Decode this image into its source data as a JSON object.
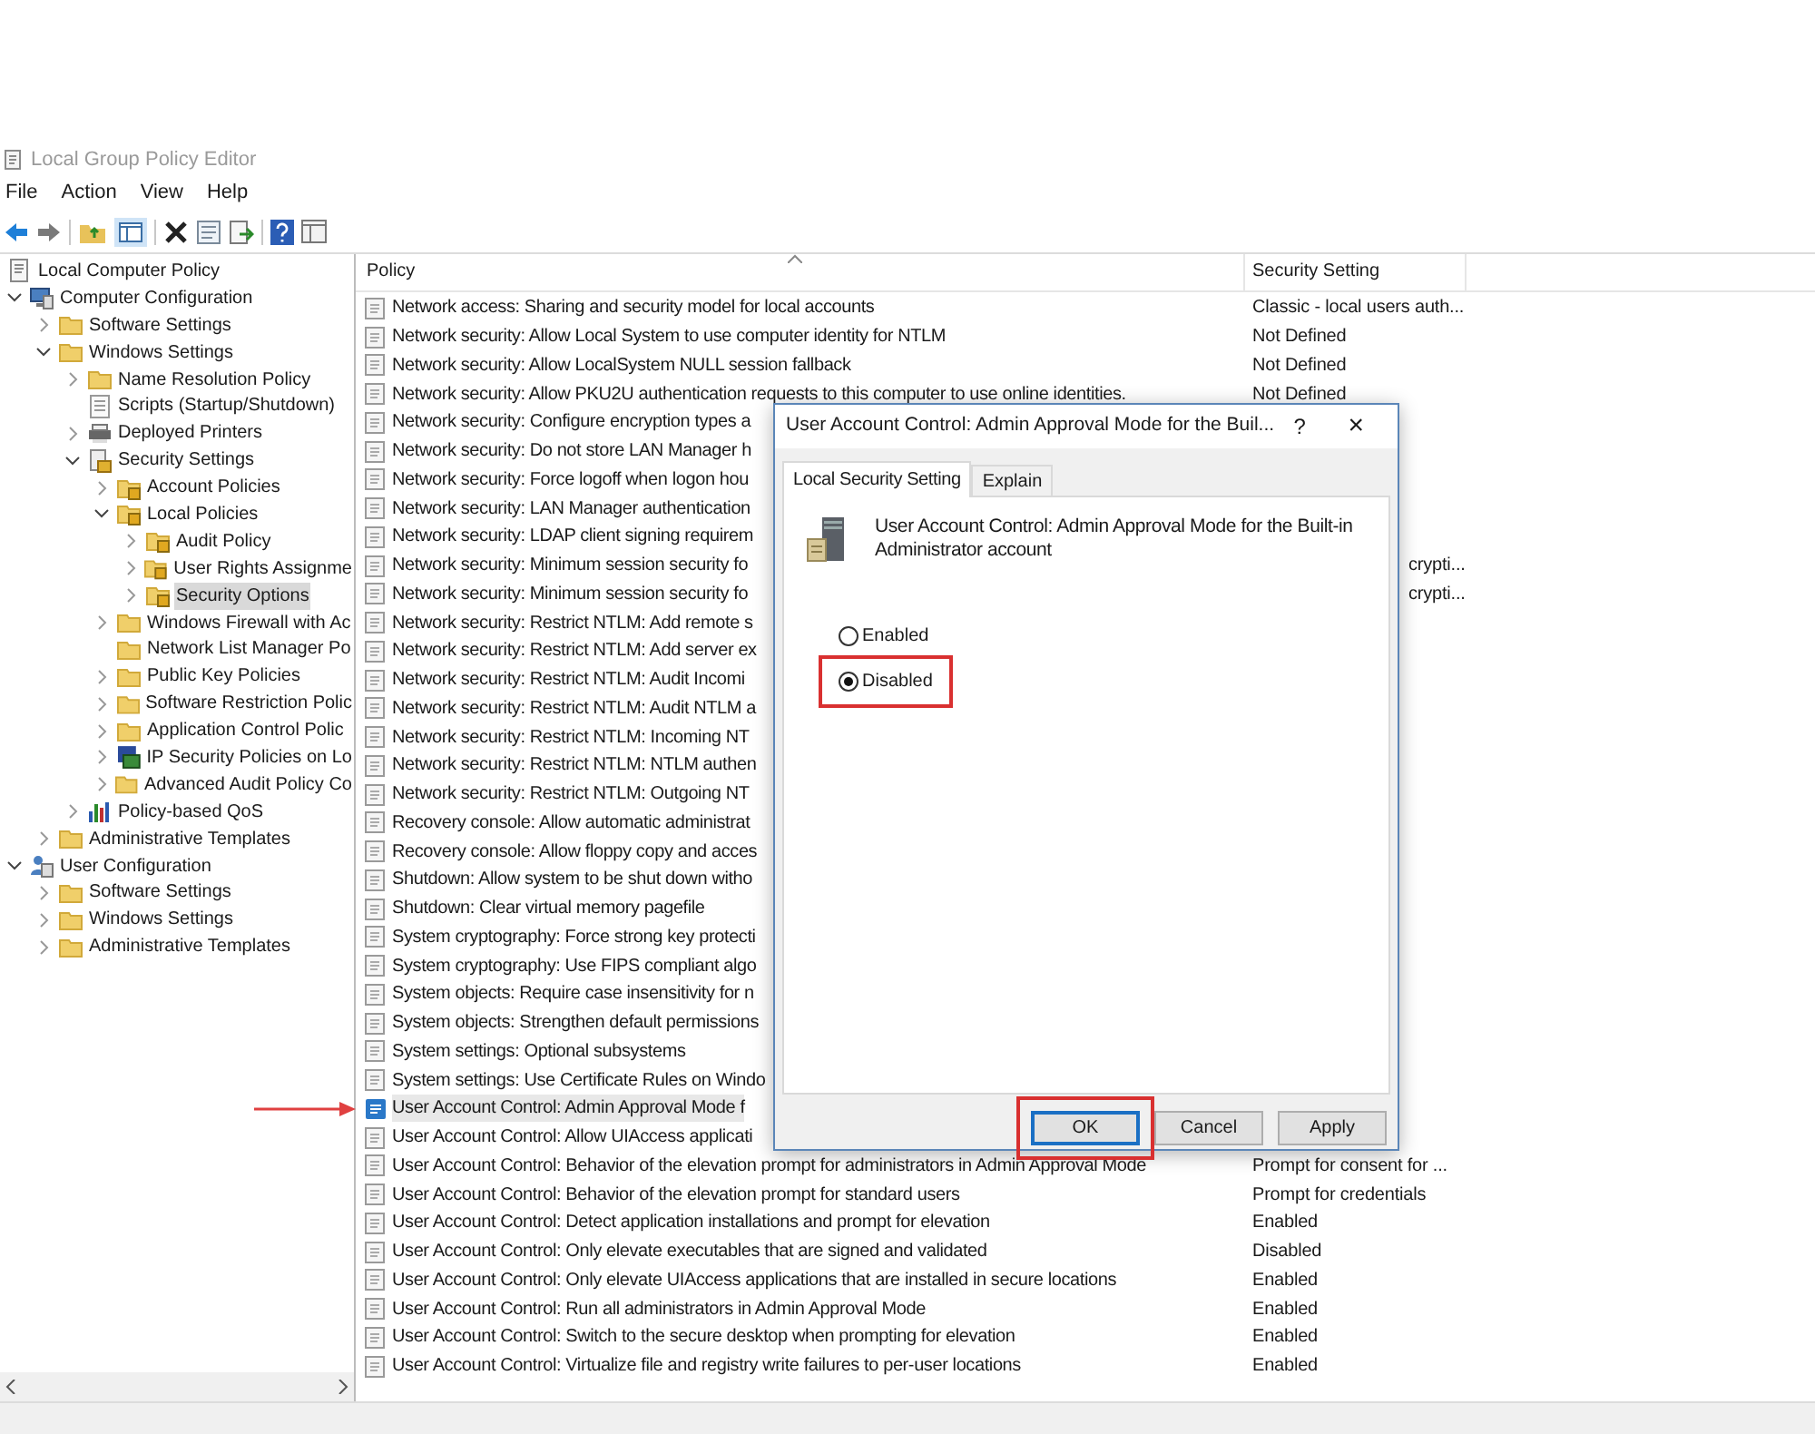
{
  "window": {
    "title": "Local Group Policy Editor"
  },
  "menu": [
    "File",
    "Action",
    "View",
    "Help"
  ],
  "tree": [
    {
      "label": "Local Computer Policy",
      "kind": "policy",
      "selected": false,
      "children": [
        {
          "label": "Computer Configuration",
          "kind": "computer",
          "expanded": true,
          "selected": false,
          "children": [
            {
              "label": "Software Settings",
              "kind": "folder",
              "expanded": false,
              "selected": false
            },
            {
              "label": "Windows Settings",
              "kind": "folder",
              "expanded": true,
              "selected": false,
              "children": [
                {
                  "label": "Name Resolution Policy",
                  "kind": "folder",
                  "expanded": false,
                  "selected": false
                },
                {
                  "label": "Scripts (Startup/Shutdown)",
                  "kind": "script",
                  "selected": false
                },
                {
                  "label": "Deployed Printers",
                  "kind": "printer",
                  "expanded": false,
                  "selected": false
                },
                {
                  "label": "Security Settings",
                  "kind": "security",
                  "expanded": true,
                  "selected": false,
                  "children": [
                    {
                      "label": "Account Policies",
                      "kind": "lockfolder",
                      "expanded": false,
                      "selected": false
                    },
                    {
                      "label": "Local Policies",
                      "kind": "lockfolder",
                      "expanded": true,
                      "selected": false,
                      "children": [
                        {
                          "label": "Audit Policy",
                          "kind": "lockfolder",
                          "expanded": false,
                          "selected": false
                        },
                        {
                          "label": "User Rights Assignme",
                          "kind": "lockfolder",
                          "expanded": false,
                          "selected": false
                        },
                        {
                          "label": "Security Options",
                          "kind": "lockfolder",
                          "expanded": false,
                          "selected": true
                        }
                      ]
                    },
                    {
                      "label": "Windows Firewall with Ac",
                      "kind": "folder",
                      "expanded": false,
                      "selected": false
                    },
                    {
                      "label": "Network List Manager Po",
                      "kind": "folder",
                      "selected": false
                    },
                    {
                      "label": "Public Key Policies",
                      "kind": "folder",
                      "expanded": false,
                      "selected": false
                    },
                    {
                      "label": "Software Restriction Polic",
                      "kind": "folder",
                      "expanded": false,
                      "selected": false
                    },
                    {
                      "label": "Application Control Polic",
                      "kind": "folder",
                      "expanded": false,
                      "selected": false
                    },
                    {
                      "label": "IP Security Policies on Lo",
                      "kind": "ipsec",
                      "expanded": false,
                      "selected": false
                    },
                    {
                      "label": "Advanced Audit Policy Co",
                      "kind": "folder",
                      "expanded": false,
                      "selected": false
                    }
                  ]
                },
                {
                  "label": "Policy-based QoS",
                  "kind": "qos",
                  "expanded": false,
                  "selected": false
                }
              ]
            },
            {
              "label": "Administrative Templates",
              "kind": "folder",
              "expanded": false,
              "selected": false
            }
          ]
        },
        {
          "label": "User Configuration",
          "kind": "user",
          "expanded": true,
          "selected": false,
          "children": [
            {
              "label": "Software Settings",
              "kind": "folder",
              "expanded": false,
              "selected": false
            },
            {
              "label": "Windows Settings",
              "kind": "folder",
              "expanded": false,
              "selected": false
            },
            {
              "label": "Administrative Templates",
              "kind": "folder",
              "expanded": false,
              "selected": false
            }
          ]
        }
      ]
    }
  ],
  "policy_list": {
    "columns": [
      "Policy",
      "Security Setting"
    ],
    "rows": [
      {
        "policy": "Network access: Sharing and security model for local accounts",
        "setting": "Classic - local users auth...",
        "selected": false,
        "callout": false
      },
      {
        "policy": "Network security: Allow Local System to use computer identity for NTLM",
        "setting": "Not Defined",
        "selected": false,
        "callout": false
      },
      {
        "policy": "Network security: Allow LocalSystem NULL session fallback",
        "setting": "Not Defined",
        "selected": false,
        "callout": false
      },
      {
        "policy": "Network security: Allow PKU2U authentication requests to this computer to use online identities.",
        "setting": "Not Defined",
        "selected": false,
        "callout": false
      },
      {
        "policy": "Network security: Configure encryption types a",
        "selected": false,
        "callout": false
      },
      {
        "policy": "Network security: Do not store LAN Manager h",
        "selected": false,
        "callout": false
      },
      {
        "policy": "Network security: Force logoff when logon hou",
        "selected": false,
        "callout": false
      },
      {
        "policy": "Network security: LAN Manager authentication",
        "selected": false,
        "callout": false
      },
      {
        "policy": "Network security: LDAP client signing requirem",
        "selected": false,
        "callout": false
      },
      {
        "policy": "Network security: Minimum session security fo",
        "setting": "crypti...",
        "selected": false,
        "callout": false
      },
      {
        "policy": "Network security: Minimum session security fo",
        "setting": "crypti...",
        "selected": false,
        "callout": false
      },
      {
        "policy": "Network security: Restrict NTLM: Add remote s",
        "selected": false,
        "callout": false
      },
      {
        "policy": "Network security: Restrict NTLM: Add server ex",
        "selected": false,
        "callout": false
      },
      {
        "policy": "Network security: Restrict NTLM: Audit Incomi",
        "selected": false,
        "callout": false
      },
      {
        "policy": "Network security: Restrict NTLM: Audit NTLM a",
        "selected": false,
        "callout": false
      },
      {
        "policy": "Network security: Restrict NTLM: Incoming NT",
        "selected": false,
        "callout": false
      },
      {
        "policy": "Network security: Restrict NTLM: NTLM authen",
        "selected": false,
        "callout": false
      },
      {
        "policy": "Network security: Restrict NTLM: Outgoing NT",
        "selected": false,
        "callout": false
      },
      {
        "policy": "Recovery console: Allow automatic administrat",
        "selected": false,
        "callout": false
      },
      {
        "policy": "Recovery console: Allow floppy copy and acces",
        "selected": false,
        "callout": false
      },
      {
        "policy": "Shutdown: Allow system to be shut down witho",
        "selected": false,
        "callout": false
      },
      {
        "policy": "Shutdown: Clear virtual memory pagefile",
        "selected": false,
        "callout": false
      },
      {
        "policy": "System cryptography: Force strong key protecti",
        "selected": false,
        "callout": false
      },
      {
        "policy": "System cryptography: Use FIPS compliant algo",
        "selected": false,
        "callout": false
      },
      {
        "policy": "System objects: Require case insensitivity for n",
        "selected": false,
        "callout": false
      },
      {
        "policy": "System objects: Strengthen default permissions",
        "selected": false,
        "callout": false
      },
      {
        "policy": "System settings: Optional subsystems",
        "selected": false,
        "callout": false
      },
      {
        "policy": "System settings: Use Certificate Rules on Windo",
        "selected": false,
        "callout": false
      },
      {
        "policy": "User Account Control: Admin Approval Mode f",
        "selected": true,
        "callout": true
      },
      {
        "policy": "User Account Control: Allow UIAccess applicati",
        "selected": false,
        "callout": false
      },
      {
        "policy": "User Account Control: Behavior of the elevation prompt for administrators in Admin Approval Mode",
        "setting": "Prompt for consent for ...",
        "selected": false,
        "callout": false
      },
      {
        "policy": "User Account Control: Behavior of the elevation prompt for standard users",
        "setting": "Prompt for credentials",
        "selected": false,
        "callout": false
      },
      {
        "policy": "User Account Control: Detect application installations and prompt for elevation",
        "setting": "Enabled",
        "selected": false,
        "callout": false
      },
      {
        "policy": "User Account Control: Only elevate executables that are signed and validated",
        "setting": "Disabled",
        "selected": false,
        "callout": false
      },
      {
        "policy": "User Account Control: Only elevate UIAccess applications that are installed in secure locations",
        "setting": "Enabled",
        "selected": false,
        "callout": false
      },
      {
        "policy": "User Account Control: Run all administrators in Admin Approval Mode",
        "setting": "Enabled",
        "selected": false,
        "callout": false
      },
      {
        "policy": "User Account Control: Switch to the secure desktop when prompting for elevation",
        "setting": "Enabled",
        "selected": false,
        "callout": false
      },
      {
        "policy": "User Account Control: Virtualize file and registry write failures to per-user locations",
        "setting": "Enabled",
        "selected": false,
        "callout": false
      }
    ]
  },
  "dialog": {
    "title": "User Account Control: Admin Approval Mode for the Buil...",
    "help": "?",
    "close": "×",
    "tabs": [
      {
        "label": "Local Security Setting",
        "selected": true
      },
      {
        "label": "Explain",
        "selected": false
      }
    ],
    "setting_name": "User Account Control: Admin Approval Mode for the Built-in Administrator account",
    "options": [
      {
        "label": "Enabled",
        "selected": false,
        "callout": false
      },
      {
        "label": "Disabled",
        "selected": true,
        "callout": true
      }
    ],
    "buttons": [
      {
        "label": "OK",
        "default": true,
        "callout": true
      },
      {
        "label": "Cancel",
        "default": false,
        "callout": false
      },
      {
        "label": "Apply",
        "default": false,
        "callout": false
      }
    ]
  }
}
